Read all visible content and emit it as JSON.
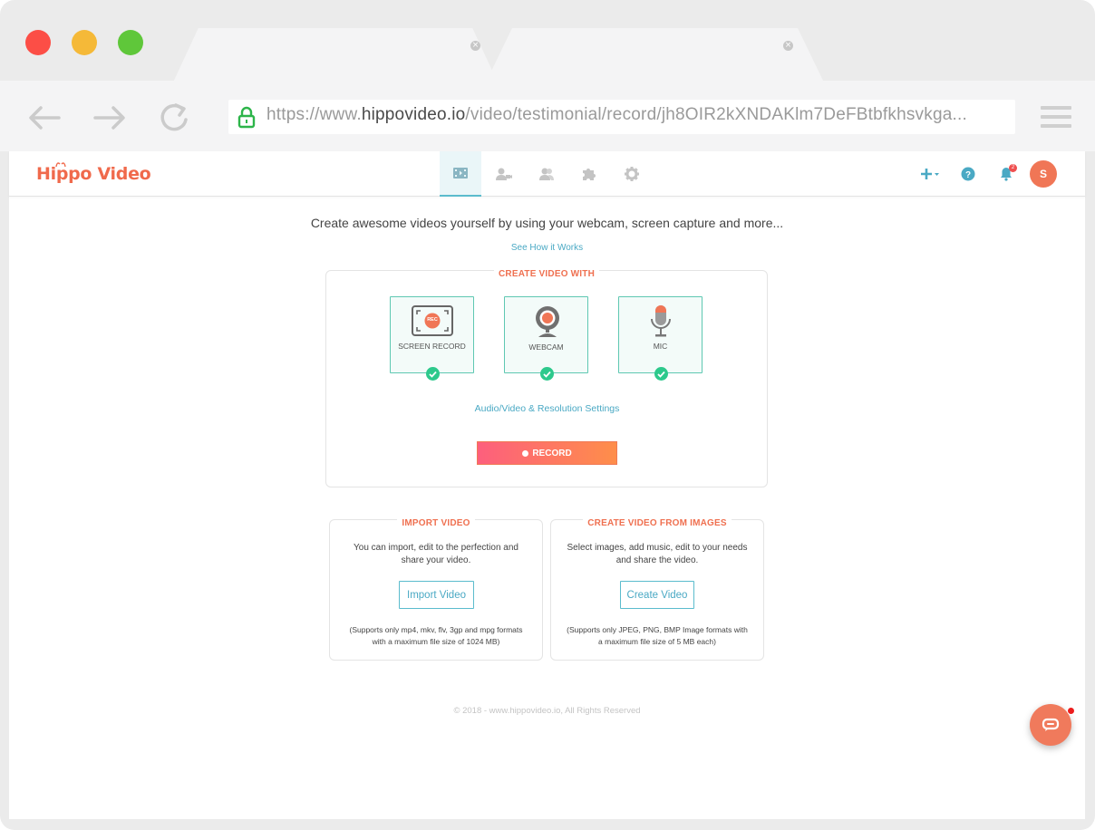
{
  "browser": {
    "url_prefix": "https://www.",
    "url_domain": "hippovideo.io",
    "url_path": "/video/testimonial/record/jh8OIR2kXNDAKlm7DeFBtbfkhsvkga..."
  },
  "app": {
    "logo": "Hippo Video",
    "notification_count": "2",
    "avatar_initial": "S"
  },
  "main": {
    "tagline": "Create awesome videos yourself by using your webcam, screen capture and more...",
    "how_link": "See How it Works"
  },
  "create_card": {
    "title": "CREATE VIDEO WITH",
    "options": [
      {
        "label": "SCREEN RECORD",
        "badge": "REC"
      },
      {
        "label": "WEBCAM"
      },
      {
        "label": "MIC"
      }
    ],
    "settings_link": "Audio/Video & Resolution Settings",
    "record_label": "RECORD"
  },
  "import_card": {
    "title": "IMPORT VIDEO",
    "desc_line1": "You can import, edit to the perfection and",
    "desc_line2": "share your video.",
    "button": "Import Video",
    "note_line1": "(Supports only mp4, mkv, flv, 3gp and mpg formats",
    "note_line2": "with a maximum file size of 1024 MB)"
  },
  "images_card": {
    "title": "CREATE VIDEO FROM IMAGES",
    "desc_line1": "Select images, add music, edit to your needs",
    "desc_line2": "and share the video.",
    "button": "Create Video",
    "note_line1": "(Supports only JPEG, PNG, BMP Image formats with",
    "note_line2": "a maximum file size of 5 MB each)"
  },
  "footer": {
    "copyright": "© 2018 - www.hippovideo.io, All Rights Reserved"
  },
  "colors": {
    "accent": "#5bbccd",
    "brand": "#f06a4c",
    "check": "#2dc98c"
  }
}
